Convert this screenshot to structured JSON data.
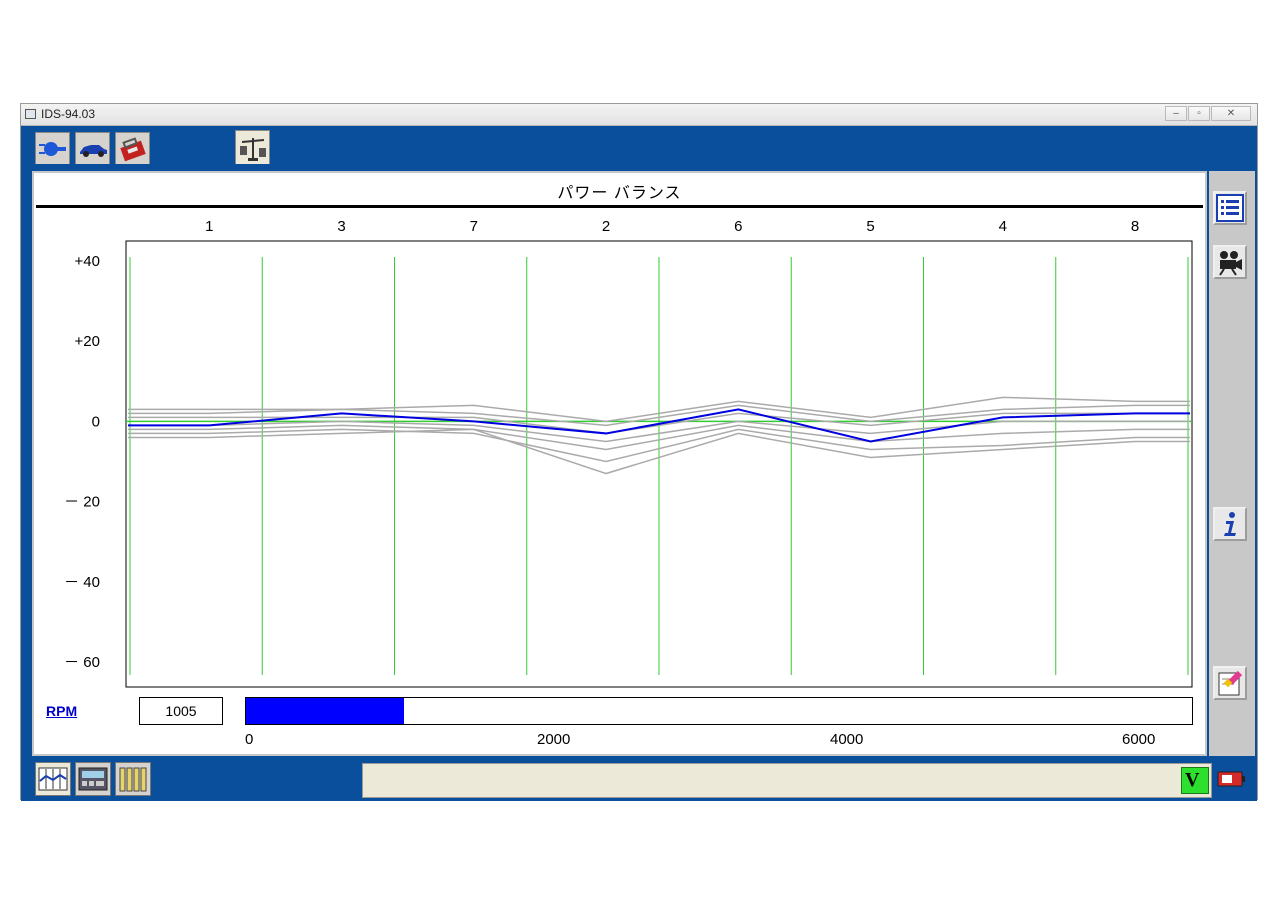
{
  "window": {
    "title": "IDS-94.03"
  },
  "screen": {
    "title": "パワー バランス"
  },
  "chart_data": {
    "type": "line",
    "title": "パワー バランス",
    "categories": [
      "1",
      "3",
      "7",
      "2",
      "6",
      "5",
      "4",
      "8"
    ],
    "y_ticks": [
      "+40",
      "+20",
      "0",
      "－ 20",
      "－ 40",
      "－ 60"
    ],
    "ylim": [
      -60,
      40
    ],
    "grid": "vertical green line at each cylinder, green zero line",
    "series": [
      {
        "color": "#0000e0",
        "values": [
          -1,
          2,
          0,
          -3,
          3,
          -5,
          1,
          2
        ]
      },
      {
        "color": "#aaaaaa",
        "values": [
          3,
          3,
          4,
          0,
          5,
          1,
          6,
          5
        ]
      },
      {
        "color": "#aaaaaa",
        "values": [
          2,
          3,
          2,
          -1,
          4,
          0,
          3,
          4
        ]
      },
      {
        "color": "#aaaaaa",
        "values": [
          1,
          1,
          1,
          -3,
          2,
          -1,
          2,
          2
        ]
      },
      {
        "color": "#aaaaaa",
        "values": [
          -1,
          0,
          -1,
          -5,
          0,
          -3,
          0,
          0
        ]
      },
      {
        "color": "#aaaaaa",
        "values": [
          -2,
          -1,
          -2,
          -7,
          -1,
          -5,
          -3,
          -2
        ]
      },
      {
        "color": "#aaaaaa",
        "values": [
          -3,
          -2,
          -3,
          -10,
          -2,
          -7,
          -6,
          -4
        ]
      },
      {
        "color": "#aaaaaa",
        "values": [
          -4,
          -3,
          -2,
          -13,
          -3,
          -9,
          -7,
          -5
        ]
      }
    ]
  },
  "rpm": {
    "label": "RPM",
    "value": "1005",
    "fraction": 0.1675,
    "ticks": [
      "0",
      "2000",
      "4000",
      "6000"
    ]
  },
  "colors": {
    "frame": "#0a4f9b",
    "grid": "#33cc33",
    "bar": "#0000ff"
  },
  "icons": {
    "top_tabs": [
      "connector-icon",
      "vehicle-icon",
      "toolbox-icon",
      "balance-scale-icon"
    ],
    "sidebar": [
      "list-icon",
      "camera-icon",
      "info-icon",
      "notepad-icon"
    ],
    "bottom_tabs": [
      "graph-icon",
      "recorder-icon",
      "battery-cells-icon"
    ],
    "status": [
      "voltage-indicator-icon",
      "battery-icon"
    ]
  },
  "status_icon_text": "V"
}
